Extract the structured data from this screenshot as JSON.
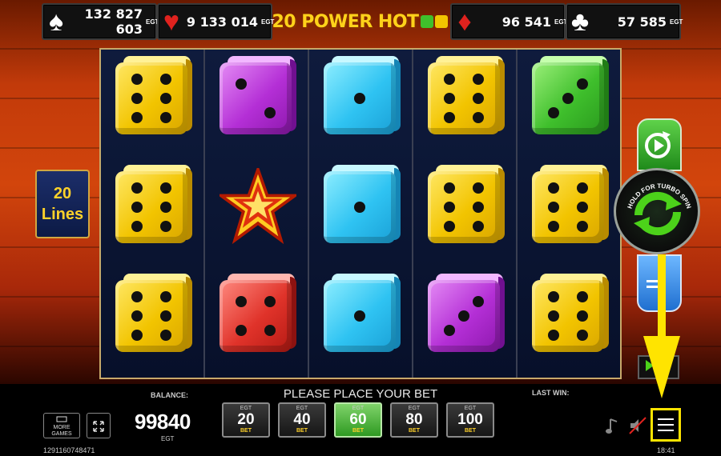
{
  "jackpots": [
    {
      "suit": "spade-icon",
      "glyph": "♠",
      "value": "132 827 603",
      "color": "#ffffff"
    },
    {
      "suit": "heart-icon",
      "glyph": "♥",
      "value": "9 133 014",
      "color": "#e0221e"
    },
    {
      "suit": "diamond-icon",
      "glyph": "♦",
      "value": "96 541",
      "color": "#e0221e"
    },
    {
      "suit": "club-icon",
      "glyph": "♣",
      "value": "57 585",
      "color": "#ffffff"
    }
  ],
  "jackpot_egt": "EGT",
  "logo": "20 POWER HOT",
  "lines": {
    "count": "20",
    "label": "Lines"
  },
  "turbo_hint": "HOLD FOR TURBO SPIN",
  "message": "PLEASE PLACE YOUR BET",
  "balance": {
    "label": "BALANCE:",
    "value": "99840",
    "currency": "EGT"
  },
  "last_win_label": "LAST WIN:",
  "bets": [
    {
      "egt": "EGT",
      "value": "20",
      "word": "BET",
      "active": false
    },
    {
      "egt": "EGT",
      "value": "40",
      "word": "BET",
      "active": false
    },
    {
      "egt": "EGT",
      "value": "60",
      "word": "BET",
      "active": true
    },
    {
      "egt": "EGT",
      "value": "80",
      "word": "BET",
      "active": false
    },
    {
      "egt": "EGT",
      "value": "100",
      "word": "BET",
      "active": false
    }
  ],
  "more_games": "MORE GAMES",
  "game_id": "1291160748471",
  "clock": "18:41",
  "reels": [
    [
      "yellow-6",
      "yellow-6",
      "yellow-6"
    ],
    [
      "purple-2",
      "star",
      "red-4"
    ],
    [
      "cyan-1",
      "cyan-1",
      "cyan-1"
    ],
    [
      "yellow-6",
      "yellow-6",
      "purple-3"
    ],
    [
      "green-3",
      "yellow-6",
      "yellow-6"
    ]
  ],
  "colors": {
    "accent": "#ffe400",
    "active_bet": "#3fa52c",
    "frame": "#c7a96a"
  }
}
